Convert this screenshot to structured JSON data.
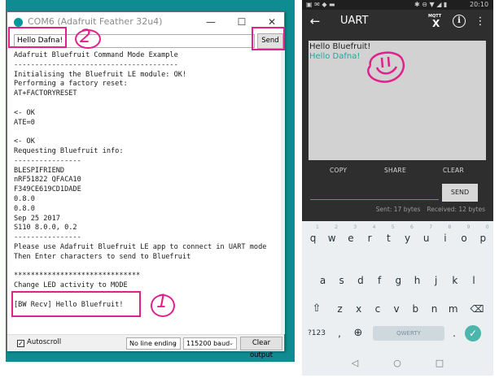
{
  "serial_monitor": {
    "title": "COM6 (Adafruit Feather 32u4)",
    "controls": {
      "minimize": "—",
      "maximize": "☐",
      "close": "✕"
    },
    "input_value": "Hello Dafna!",
    "send_label": "Send",
    "output_lines": [
      "Adafruit Bluefruit Command Mode Example",
      "---------------------------------------",
      "Initialising the Bluefruit LE module: OK!",
      "Performing a factory reset:",
      "AT+FACTORYRESET",
      "",
      "<- OK",
      "ATE=0",
      "",
      "<- OK",
      "Requesting Bluefruit info:",
      "----------------",
      "BLESPIFRIEND",
      "nRF51822 QFACA10",
      "F349CE619CD1DADE",
      "0.8.0",
      "0.8.0",
      "Sep 25 2017",
      "S110 8.0.0, 0.2",
      "----------------",
      "Please use Adafruit Bluefruit LE app to connect in UART mode",
      "Then Enter characters to send to Bluefruit",
      "",
      "******************************",
      "Change LED activity to MODE",
      "",
      "[BW Recv] Hello Bluefruit!"
    ],
    "autoscroll_label": "Autoscroll",
    "autoscroll_checked": true,
    "line_ending": "No line ending",
    "baud": "115200 baud",
    "clear_label": "Clear output"
  },
  "annotations": {
    "mark_1": "1",
    "mark_2": "2",
    "smiley": "ü",
    "color": "#e0208c"
  },
  "phone": {
    "status_time": "20:10",
    "title": "UART",
    "mqtt_label": "MQTT",
    "mqtt_x": "X",
    "info_label": "i",
    "uart_lines": {
      "sent": "Hello Bluefruit!",
      "received": "Hello Dafna!"
    },
    "received_color": "#1fa89b",
    "actions": {
      "copy": "COPY",
      "share": "SHARE",
      "clear": "CLEAR"
    },
    "send_label": "SEND",
    "stats": {
      "sent": "Sent: 17 bytes",
      "received": "Received: 12 bytes"
    },
    "keyboard": {
      "row1": [
        "q",
        "w",
        "e",
        "r",
        "t",
        "y",
        "u",
        "i",
        "o",
        "p"
      ],
      "row1_hints": [
        "1",
        "2",
        "3",
        "4",
        "5",
        "6",
        "7",
        "8",
        "9",
        "0"
      ],
      "row2": [
        "a",
        "s",
        "d",
        "f",
        "g",
        "h",
        "j",
        "k",
        "l"
      ],
      "row3": [
        "z",
        "x",
        "c",
        "v",
        "b",
        "n",
        "m"
      ],
      "symbols_key": "?123",
      "comma_key": ",",
      "period_key": ".",
      "space_label": "QWERTY"
    }
  }
}
